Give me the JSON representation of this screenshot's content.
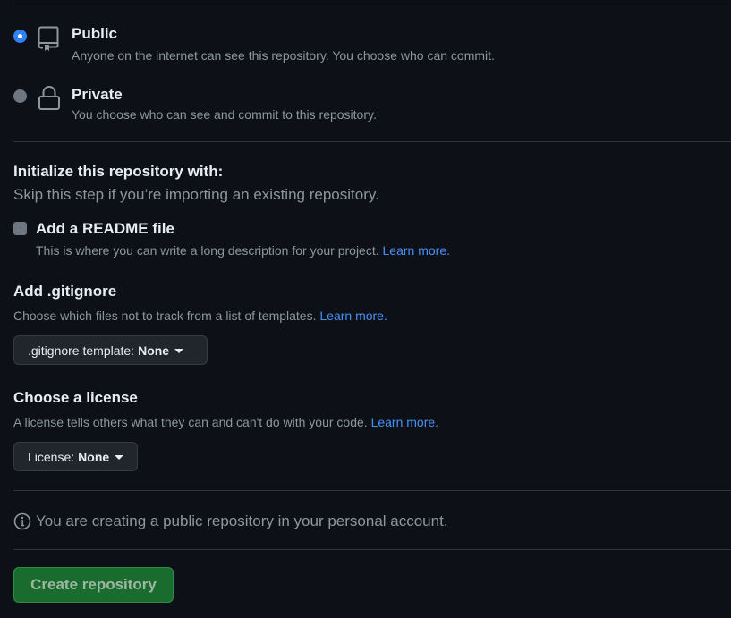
{
  "visibility": {
    "public": {
      "title": "Public",
      "description": "Anyone on the internet can see this repository. You choose who can commit.",
      "selected": true,
      "icon": "repo-icon"
    },
    "private": {
      "title": "Private",
      "description": "You choose who can see and commit to this repository.",
      "selected": false,
      "icon": "lock-icon"
    }
  },
  "initialize": {
    "title": "Initialize this repository with:",
    "subtitle": "Skip this step if you’re importing an existing repository.",
    "readme": {
      "label": "Add a README file",
      "description": "This is where you can write a long description for your project.",
      "link": "Learn more.",
      "checked": false
    }
  },
  "gitignore": {
    "title": "Add .gitignore",
    "description": "Choose which files not to track from a list of templates.",
    "link": "Learn more.",
    "button_prefix": ".gitignore template:",
    "button_value": "None"
  },
  "license": {
    "title": "Choose a license",
    "description": "A license tells others what they can and can't do with your code.",
    "link": "Learn more.",
    "button_prefix": "License:",
    "button_value": "None"
  },
  "info": {
    "icon": "info-icon",
    "text": "You are creating a public repository in your personal account."
  },
  "submit": {
    "label": "Create repository"
  },
  "colors": {
    "background": "#0d1117",
    "link": "#4493f8",
    "primary_button": "#196c2e",
    "selected_radio": "#2f81f7"
  }
}
